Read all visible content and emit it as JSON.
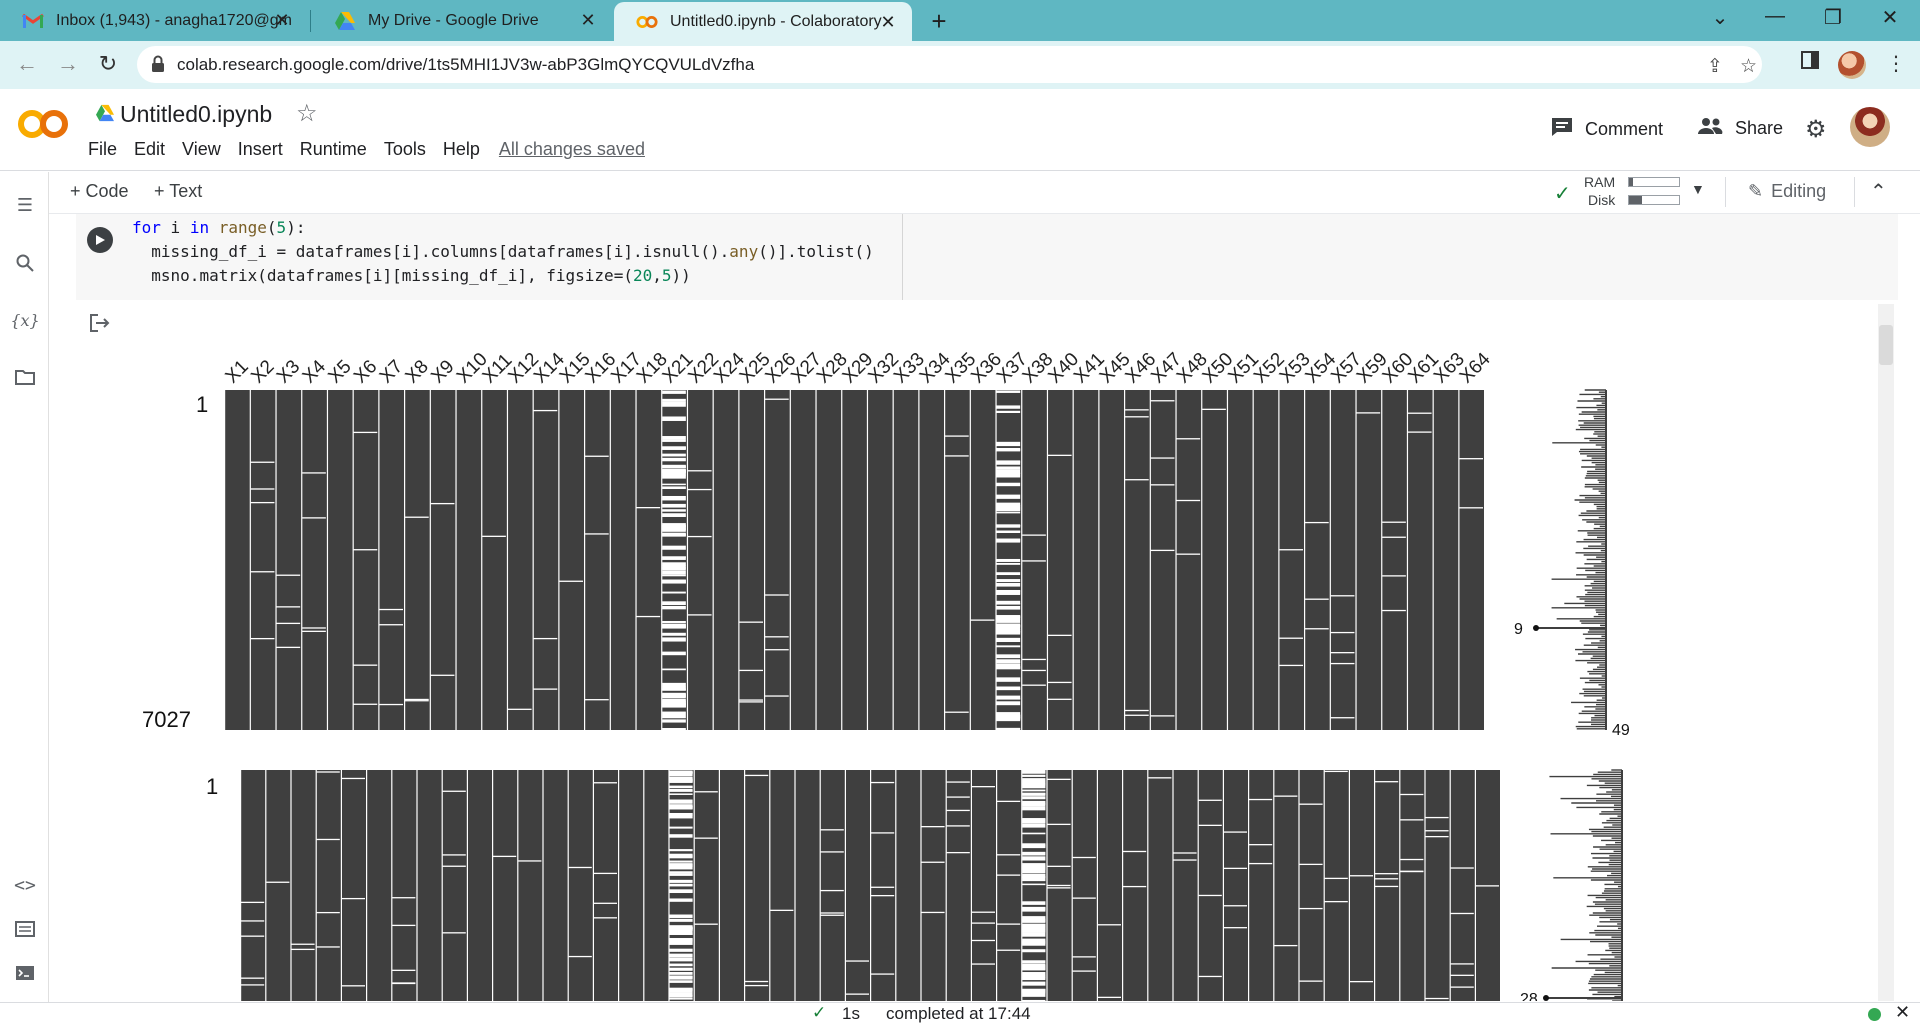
{
  "browser": {
    "tabs": [
      {
        "title": "Inbox (1,943) - anagha1720@gm",
        "icon": "gmail-icon",
        "active": false
      },
      {
        "title": "My Drive - Google Drive",
        "icon": "drive-icon",
        "active": false
      },
      {
        "title": "Untitled0.ipynb - Colaboratory",
        "icon": "colab-icon",
        "active": true
      }
    ],
    "url": "colab.research.google.com/drive/1ts5MHI1JV3w-abP3GlmQYCQVULdVzfha"
  },
  "colab": {
    "title": "Untitled0.ipynb",
    "menu": [
      "File",
      "Edit",
      "View",
      "Insert",
      "Runtime",
      "Tools",
      "Help"
    ],
    "save_status": "All changes saved",
    "comment_label": "Comment",
    "share_label": "Share",
    "add_code_label": "Code",
    "add_text_label": "Text",
    "ram_label": "RAM",
    "disk_label": "Disk",
    "ram_fraction": 0.08,
    "disk_fraction": 0.25,
    "editing_label": "Editing"
  },
  "cell": {
    "code_lines": [
      "for i in range(5):",
      "  missing_df_i = dataframes[i].columns[dataframes[i].isnull().any()].tolist()",
      "  msno.matrix(dataframes[i][missing_df_i], figsize=(20,5))"
    ]
  },
  "status": {
    "elapsed": "1s",
    "message": "completed at 17:44"
  },
  "chart_data": [
    {
      "type": "heatmap",
      "description_kind": "missingno matrix",
      "columns": [
        "X1",
        "X2",
        "X3",
        "X4",
        "X5",
        "X6",
        "X7",
        "X8",
        "X9",
        "X10",
        "X11",
        "X12",
        "X14",
        "X15",
        "X16",
        "X17",
        "X18",
        "X21",
        "X22",
        "X24",
        "X25",
        "X26",
        "X27",
        "X28",
        "X29",
        "X32",
        "X33",
        "X34",
        "X35",
        "X36",
        "X37",
        "X38",
        "X40",
        "X41",
        "X45",
        "X46",
        "X47",
        "X48",
        "X50",
        "X51",
        "X52",
        "X53",
        "X54",
        "X57",
        "X59",
        "X60",
        "X61",
        "X63",
        "X64"
      ],
      "rows_top_label": "1",
      "rows_bottom_label": "7027",
      "sparkline_min_label": "9",
      "sparkline_max_label": "49",
      "dense_missing_columns": [
        "X21",
        "X37"
      ],
      "colors": {
        "present": "#3f3f3f",
        "missing": "#ffffff"
      }
    },
    {
      "type": "heatmap",
      "description_kind": "missingno matrix",
      "column_count": 50,
      "rows_top_label": "1",
      "sparkline_min_label": "28",
      "colors": {
        "present": "#3f3f3f",
        "missing": "#ffffff"
      }
    }
  ]
}
